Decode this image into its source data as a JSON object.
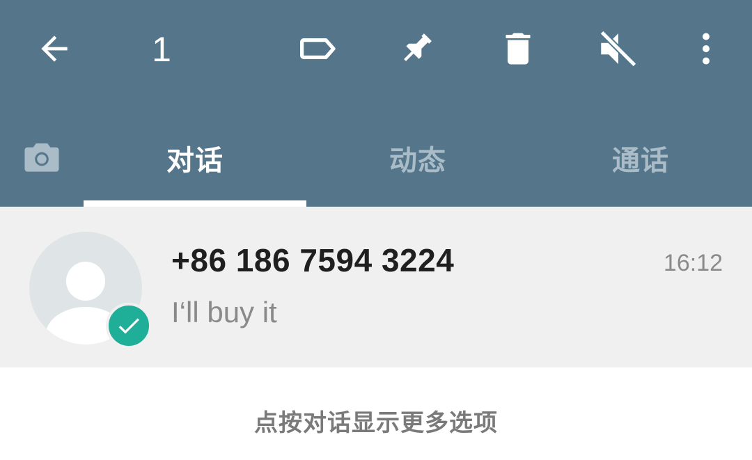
{
  "toolbar": {
    "selected_count": "1",
    "icons": [
      "back-arrow-icon",
      "label-icon",
      "pin-icon",
      "delete-icon",
      "mute-icon",
      "more-options-icon"
    ]
  },
  "tabs": {
    "camera_icon": "camera-icon",
    "items": [
      {
        "label": "对话",
        "active": true
      },
      {
        "label": "动态",
        "active": false
      },
      {
        "label": "通话",
        "active": false
      }
    ]
  },
  "chat": {
    "name": "+86 186 7594 3224",
    "preview": "I‘ll buy it",
    "time": "16:12",
    "selected": true
  },
  "hint": "点按对话显示更多选项",
  "colors": {
    "appbar": "#54758a",
    "selected_row": "#f0f0f0",
    "check_badge": "#1fae97",
    "inactive_tab": "#a9bcc8"
  }
}
